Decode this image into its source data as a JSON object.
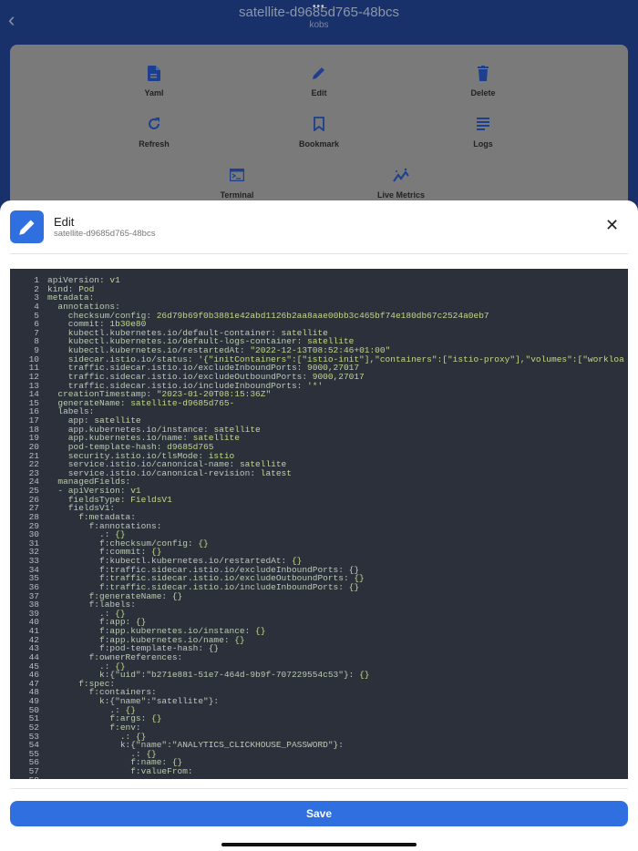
{
  "header": {
    "title": "satellite-d9685d765-48bcs",
    "subtitle": "kobs"
  },
  "actions": [
    {
      "label": "Yaml",
      "icon": "file-icon"
    },
    {
      "label": "Edit",
      "icon": "pencil-icon"
    },
    {
      "label": "Delete",
      "icon": "trash-icon"
    },
    {
      "label": "Refresh",
      "icon": "refresh-icon"
    },
    {
      "label": "Bookmark",
      "icon": "bookmark-icon"
    },
    {
      "label": "Logs",
      "icon": "list-icon"
    },
    {
      "label": "Terminal",
      "icon": "terminal-icon"
    },
    {
      "label": "Live Metrics",
      "icon": "sparkline-icon"
    }
  ],
  "sheet": {
    "title": "Edit",
    "subtitle": "satellite-d9685d765-48bcs",
    "save_label": "Save"
  },
  "colors": {
    "accent": "#2f6fe0",
    "header": "#18316b",
    "editor_bg": "#2b303b"
  },
  "code_lines": [
    "apiVersion: v1",
    "kind: Pod",
    "metadata:",
    "  annotations:",
    "    checksum/config: 26d79b69f0b3881e42abd1126b2aa8aae00bb3c465bf74e180db67c2524a0eb7",
    "    commit: 1b30e80",
    "    kubectl.kubernetes.io/default-container: satellite",
    "    kubectl.kubernetes.io/default-logs-container: satellite",
    "    kubectl.kubernetes.io/restartedAt: \"2022-12-13T08:52:46+01:00\"",
    "    sidecar.istio.io/status: '{\"initContainers\":[\"istio-init\"],\"containers\":[\"istio-proxy\"],\"volumes\":[\"workloa",
    "    traffic.sidecar.istio.io/excludeInboundPorts: 9000,27017",
    "    traffic.sidecar.istio.io/excludeOutboundPorts: 9000,27017",
    "    traffic.sidecar.istio.io/includeInboundPorts: '*'",
    "  creationTimestamp: \"2023-01-20T08:15:36Z\"",
    "  generateName: satellite-d9685d765-",
    "  labels:",
    "    app: satellite",
    "    app.kubernetes.io/instance: satellite",
    "    app.kubernetes.io/name: satellite",
    "    pod-template-hash: d9685d765",
    "    security.istio.io/tlsMode: istio",
    "    service.istio.io/canonical-name: satellite",
    "    service.istio.io/canonical-revision: latest",
    "  managedFields:",
    "  - apiVersion: v1",
    "    fieldsType: FieldsV1",
    "    fieldsV1:",
    "      f:metadata:",
    "        f:annotations:",
    "          .: {}",
    "          f:checksum/config: {}",
    "          f:commit: {}",
    "          f:kubectl.kubernetes.io/restartedAt: {}",
    "          f:traffic.sidecar.istio.io/excludeInboundPorts: {}",
    "          f:traffic.sidecar.istio.io/excludeOutboundPorts: {}",
    "          f:traffic.sidecar.istio.io/includeInboundPorts: {}",
    "        f:generateName: {}",
    "        f:labels:",
    "          .: {}",
    "          f:app: {}",
    "          f:app.kubernetes.io/instance: {}",
    "          f:app.kubernetes.io/name: {}",
    "          f:pod-template-hash: {}",
    "        f:ownerReferences:",
    "          .: {}",
    "          k:{\"uid\":\"b271e881-51e7-464d-9b9f-707229554c53\"}: {}",
    "      f:spec:",
    "        f:containers:",
    "          k:{\"name\":\"satellite\"}:",
    "            .: {}",
    "            f:args: {}",
    "            f:env:",
    "              .: {}",
    "              k:{\"name\":\"ANALYTICS_CLICKHOUSE_PASSWORD\"}:",
    "                .: {}",
    "                f:name: {}",
    "                f:valueFrom:"
  ]
}
